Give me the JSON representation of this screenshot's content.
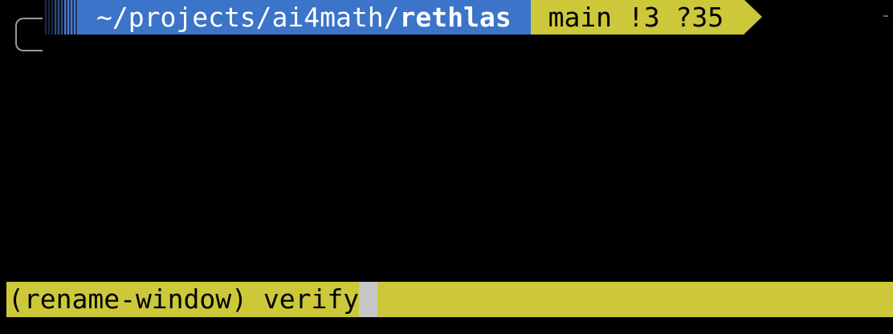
{
  "prompt": {
    "directory_prefix": "~/projects/ai4math/",
    "directory_current": "rethlas",
    "git_status": "main !3 ?35"
  },
  "status_bar": {
    "command": "(rename-window) verify"
  },
  "colors": {
    "background": "#000000",
    "dir_segment": "#3b74c8",
    "git_segment": "#ccc83a",
    "status_bar": "#ccc83a",
    "cursor": "#c8c8c8"
  }
}
